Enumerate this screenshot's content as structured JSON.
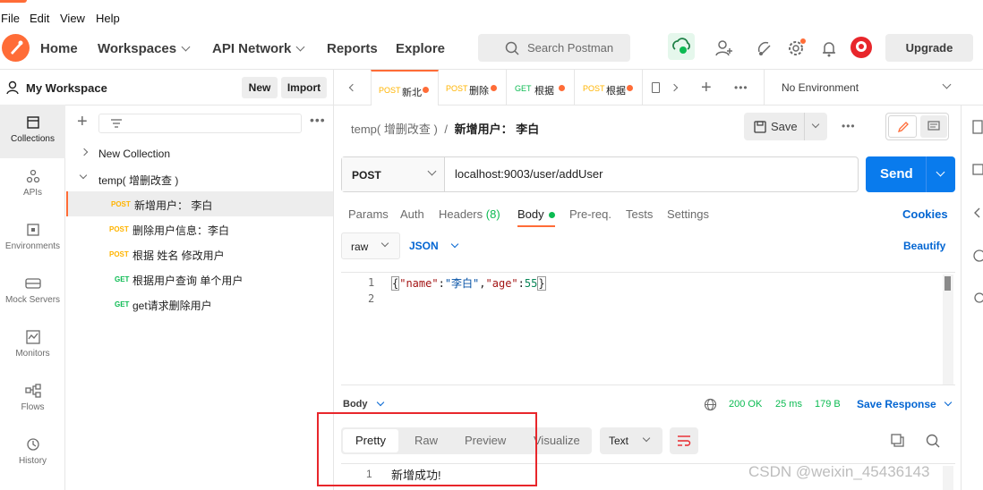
{
  "menu": {
    "file": "File",
    "edit": "Edit",
    "view": "View",
    "help": "Help"
  },
  "header": {
    "home": "Home",
    "workspaces": "Workspaces",
    "api_network": "API Network",
    "reports": "Reports",
    "explore": "Explore",
    "search_placeholder": "Search Postman",
    "upgrade": "Upgrade"
  },
  "workspace": {
    "title": "My Workspace",
    "new_label": "New",
    "import_label": "Import"
  },
  "rail": [
    {
      "label": "Collections"
    },
    {
      "label": "APIs"
    },
    {
      "label": "Environments"
    },
    {
      "label": "Mock Servers"
    },
    {
      "label": "Monitors"
    },
    {
      "label": "Flows"
    },
    {
      "label": "History"
    }
  ],
  "tree": {
    "new_collection": "New Collection",
    "folder": "temp( 增删改查 )",
    "requests": [
      {
        "method": "POST",
        "name": "新增用户： 李白"
      },
      {
        "method": "POST",
        "name": "删除用户信息：李白"
      },
      {
        "method": "POST",
        "name": "根据 姓名 修改用户"
      },
      {
        "method": "GET",
        "name": "根据用户查询 单个用户"
      },
      {
        "method": "GET",
        "name": "get请求删除用户"
      }
    ]
  },
  "tabs": [
    {
      "method": "POST",
      "name": "新北"
    },
    {
      "method": "POST",
      "name": "删除"
    },
    {
      "method": "GET",
      "name": "根据"
    },
    {
      "method": "POST",
      "name": "根据"
    }
  ],
  "environment": "No Environment",
  "request": {
    "breadcrumb_parent": "temp( 增删改查 )",
    "breadcrumb_sep": "/",
    "breadcrumb_current": "新增用户： 李白",
    "save_label": "Save",
    "method": "POST",
    "url": "localhost:9003/user/addUser",
    "send_label": "Send",
    "subtabs": [
      "Params",
      "Auth",
      "Headers",
      "(8)",
      "Body",
      "Pre-req.",
      "Tests",
      "Settings"
    ],
    "cookies": "Cookies",
    "body_mode": "raw",
    "body_lang": "JSON",
    "beautify": "Beautify",
    "body_line_numbers": [
      "1",
      "2"
    ],
    "body_code_open": "{",
    "body_code_k1": "\"name\"",
    "body_code_c1": ":",
    "body_code_v1": "\"李白\"",
    "body_code_c2": ",",
    "body_code_k2": "\"age\"",
    "body_code_c3": ":",
    "body_code_v2": "55",
    "body_code_close": "}"
  },
  "response": {
    "label": "Body",
    "status": "200 OK",
    "time": "25 ms",
    "size": "179 B",
    "save_response": "Save Response",
    "tabs": [
      "Pretty",
      "Raw",
      "Preview",
      "Visualize"
    ],
    "format": "Text",
    "line_number": "1",
    "body": "新增成功!"
  },
  "watermark": "CSDN @weixin_45436143",
  "colors": {
    "accent": "#ff6c37",
    "send": "#097bed",
    "link": "#0265d2",
    "post": "#ffb400",
    "get": "#0cbb52",
    "highlight": "#e8262b"
  }
}
